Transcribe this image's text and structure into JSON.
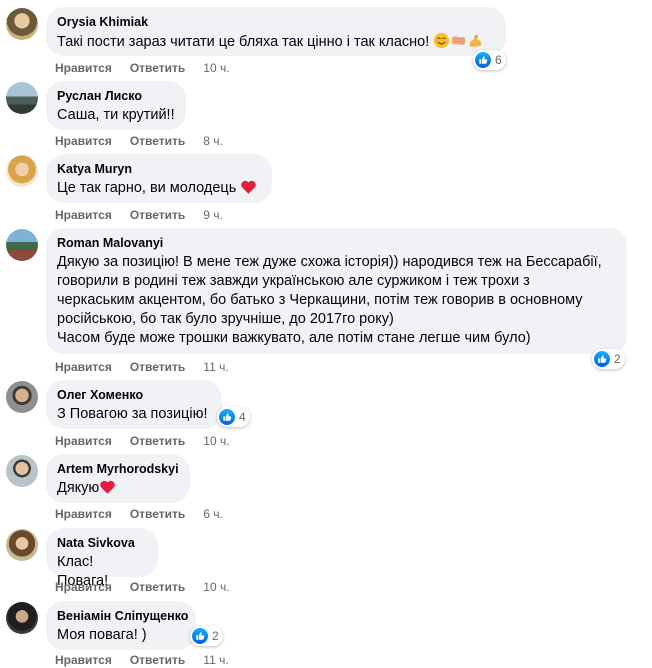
{
  "colors": {
    "bubble": "#f0f2f5",
    "action_text": "#65676b",
    "like_blue": "#0866ff",
    "heart_red": "#e41e3f"
  },
  "actions": {
    "like_label": "Нравится",
    "reply_label": "Ответить"
  },
  "comments": [
    {
      "author": "Orysia Khimiak",
      "text": "Такі пости зараз читати це бляха так цінно і так класно!",
      "emojis": [
        "relieved-face-emoji",
        "fist-bump-emoji",
        "flexed-biceps-emoji"
      ],
      "time": "10 ч.",
      "reactions": "6",
      "reaction_icon": "like-icon"
    },
    {
      "author": "Руслан Лиско",
      "text": "Саша, ти крутий!!",
      "time": "8 ч."
    },
    {
      "author": "Katya Muryn",
      "text": "Це так гарно, ви молодець",
      "emojis": [
        "red-heart-emoji"
      ],
      "time": "9 ч."
    },
    {
      "author": "Roman Malovanyi",
      "text": "Дякую за позицію! В мене теж дуже схожа історія)) народився теж на Бессарабії,\nговорили в родині теж завжди українською але суржиком і теж трохи з\nчеркаським акцентом, бо батько з Черкащини, потім теж говорив в основному\nросійською, бо так було зручніше, до 2017го року)\nЧасом буде може трошки важкувато, але потім стане легше чим було)",
      "time": "11 ч.",
      "reactions": "2",
      "reaction_icon": "like-icon"
    },
    {
      "author": "Олег Хоменко",
      "text": "З Повагою за позицію!",
      "time": "10 ч.",
      "reactions": "4",
      "reaction_icon": "like-icon"
    },
    {
      "author": "Artem Myrhorodskyi",
      "text": "Дякую",
      "emojis": [
        "red-heart-emoji"
      ],
      "time": "6 ч."
    },
    {
      "author": "Nata Sivkova",
      "text": "Клас! Повага!",
      "time": "10 ч."
    },
    {
      "author": "Веніамін Сліпущенко",
      "text": "Моя повага! )",
      "time": "11 ч.",
      "reactions": "2",
      "reaction_icon": "like-icon"
    }
  ]
}
